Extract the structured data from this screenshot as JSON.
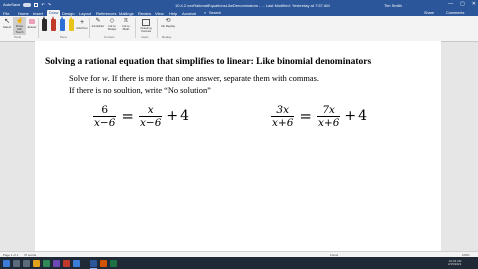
{
  "titlebar": {
    "autosave_label": "AutoSave",
    "document_name": "10.4.2.xxxRationalEquationsLikeDenominators - ... Last Modified: Yesterday at 7:57 AM",
    "user_name": "Tim Smith",
    "window_controls": [
      "—",
      "▢",
      "✕"
    ]
  },
  "menu": {
    "tabs": [
      "File",
      "Home",
      "Insert",
      "Draw",
      "Design",
      "Layout",
      "References",
      "Mailings",
      "Review",
      "View",
      "Help",
      "Acrobat"
    ],
    "active_tab": "Draw",
    "search_label": "Search",
    "share_label": "Share",
    "comments_label": "Comments"
  },
  "ribbon": {
    "tools": [
      "Select",
      "Draw with Touch",
      "Eraser"
    ],
    "add_pen_label": "Add Pen",
    "convert_buttons": [
      "Ink Editor",
      "Ink to Shape",
      "Ink to Math"
    ],
    "insert_buttons": [
      "Drawing Canvas"
    ],
    "replay_label": "Ink Replay",
    "groups": [
      "Tools",
      "Pens",
      "Convert",
      "Insert",
      "Replay"
    ],
    "pen_colors": [
      "#2b2b2b",
      "#c0392b",
      "#2d6fd6",
      "#e8c31a"
    ]
  },
  "document": {
    "title": "Solving a rational equation that simplifies to linear: Like binomial denominators",
    "instruction_part1": "Solve for ",
    "instruction_var": "w",
    "instruction_part2": ".  If there is more than one answer, separate them with commas.",
    "instruction_line2": "If there is no soultion, write “No solution”",
    "equation1": {
      "left_num": "6",
      "left_den": "x−6",
      "equals": "=",
      "right_num": "x",
      "right_den": "x−6",
      "plus": "+",
      "constant": "4"
    },
    "equation2": {
      "left_num": "3x",
      "left_den": "x+6",
      "equals": "=",
      "right_num": "7x",
      "right_den": "x+6",
      "plus": "+",
      "constant": "4"
    }
  },
  "status_bar": {
    "page_info": "Page 1 of 1",
    "word_count": "37 words",
    "focus_label": "Focus",
    "zoom": "100%"
  },
  "taskbar": {
    "time": "10:04 AM",
    "date": "2/15/2021"
  }
}
